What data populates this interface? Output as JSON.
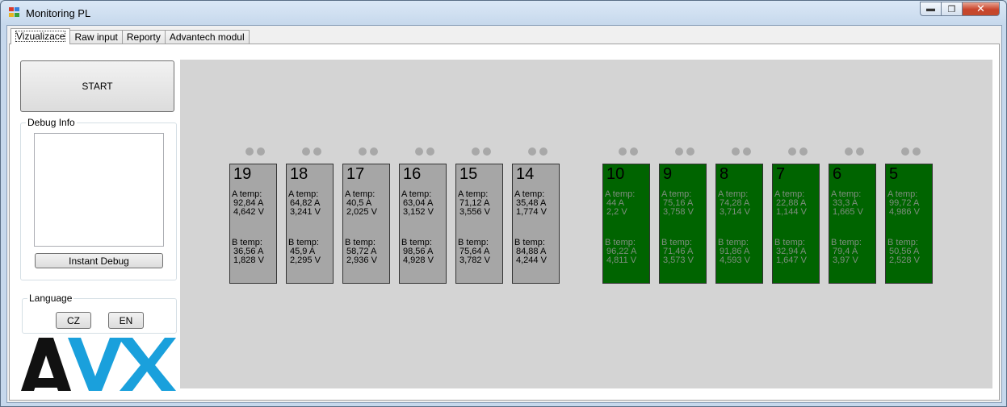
{
  "window": {
    "title": "Monitoring PL"
  },
  "tabs": [
    "Vizualizace",
    "Raw input",
    "Reporty",
    "Advantech modul"
  ],
  "sidebar": {
    "start_label": "START",
    "debug_group_label": "Debug Info",
    "instant_debug_label": "Instant Debug",
    "language_group_label": "Language",
    "lang_cz": "CZ",
    "lang_en": "EN",
    "logo_text": "AVX"
  },
  "colors": {
    "logo_blue": "#1aa0dc",
    "card_gray": "#a6a6a6",
    "card_green": "#006400",
    "panel_bg": "#d4d4d4"
  },
  "cards": [
    {
      "num": "19",
      "a_label": "A temp:",
      "a_amp": "92,84 A",
      "a_volt": "4,642 V",
      "b_label": "B temp:",
      "b_amp": "36,56 A",
      "b_volt": "1,828 V",
      "state": "gray"
    },
    {
      "num": "18",
      "a_label": "A temp:",
      "a_amp": "64,82 A",
      "a_volt": "3,241 V",
      "b_label": "B temp:",
      "b_amp": "45,9 A",
      "b_volt": "2,295 V",
      "state": "gray"
    },
    {
      "num": "17",
      "a_label": "A temp:",
      "a_amp": "40,5 A",
      "a_volt": "2,025 V",
      "b_label": "B temp:",
      "b_amp": "58,72 A",
      "b_volt": "2,936 V",
      "state": "gray"
    },
    {
      "num": "16",
      "a_label": "A temp:",
      "a_amp": "63,04 A",
      "a_volt": "3,152 V",
      "b_label": "B temp:",
      "b_amp": "98,56 A",
      "b_volt": "4,928 V",
      "state": "gray"
    },
    {
      "num": "15",
      "a_label": "A temp:",
      "a_amp": "71,12 A",
      "a_volt": "3,556 V",
      "b_label": "B temp:",
      "b_amp": "75,64 A",
      "b_volt": "3,782 V",
      "state": "gray"
    },
    {
      "num": "14",
      "a_label": "A temp:",
      "a_amp": "35,48 A",
      "a_volt": "1,774 V",
      "b_label": "B temp:",
      "b_amp": "84,88 A",
      "b_volt": "4,244 V",
      "state": "gray"
    },
    {
      "num": "10",
      "a_label": "A temp:",
      "a_amp": "44 A",
      "a_volt": "2,2 V",
      "b_label": "B temp:",
      "b_amp": "96,22 A",
      "b_volt": "4,811 V",
      "state": "green"
    },
    {
      "num": "9",
      "a_label": "A temp:",
      "a_amp": "75,16 A",
      "a_volt": "3,758 V",
      "b_label": "B temp:",
      "b_amp": "71,46 A",
      "b_volt": "3,573 V",
      "state": "green"
    },
    {
      "num": "8",
      "a_label": "A temp:",
      "a_amp": "74,28 A",
      "a_volt": "3,714 V",
      "b_label": "B temp:",
      "b_amp": "91,86 A",
      "b_volt": "4,593 V",
      "state": "green"
    },
    {
      "num": "7",
      "a_label": "A temp:",
      "a_amp": "22,88 A",
      "a_volt": "1,144 V",
      "b_label": "B temp:",
      "b_amp": "32,94 A",
      "b_volt": "1,647 V",
      "state": "green"
    },
    {
      "num": "6",
      "a_label": "A temp:",
      "a_amp": "33,3 A",
      "a_volt": "1,665 V",
      "b_label": "B temp:",
      "b_amp": "79,4 A",
      "b_volt": "3,97 V",
      "state": "green"
    },
    {
      "num": "5",
      "a_label": "A temp:",
      "a_amp": "99,72 A",
      "a_volt": "4,986 V",
      "b_label": "B temp:",
      "b_amp": "50,56 A",
      "b_volt": "2,528 V",
      "state": "green"
    }
  ]
}
